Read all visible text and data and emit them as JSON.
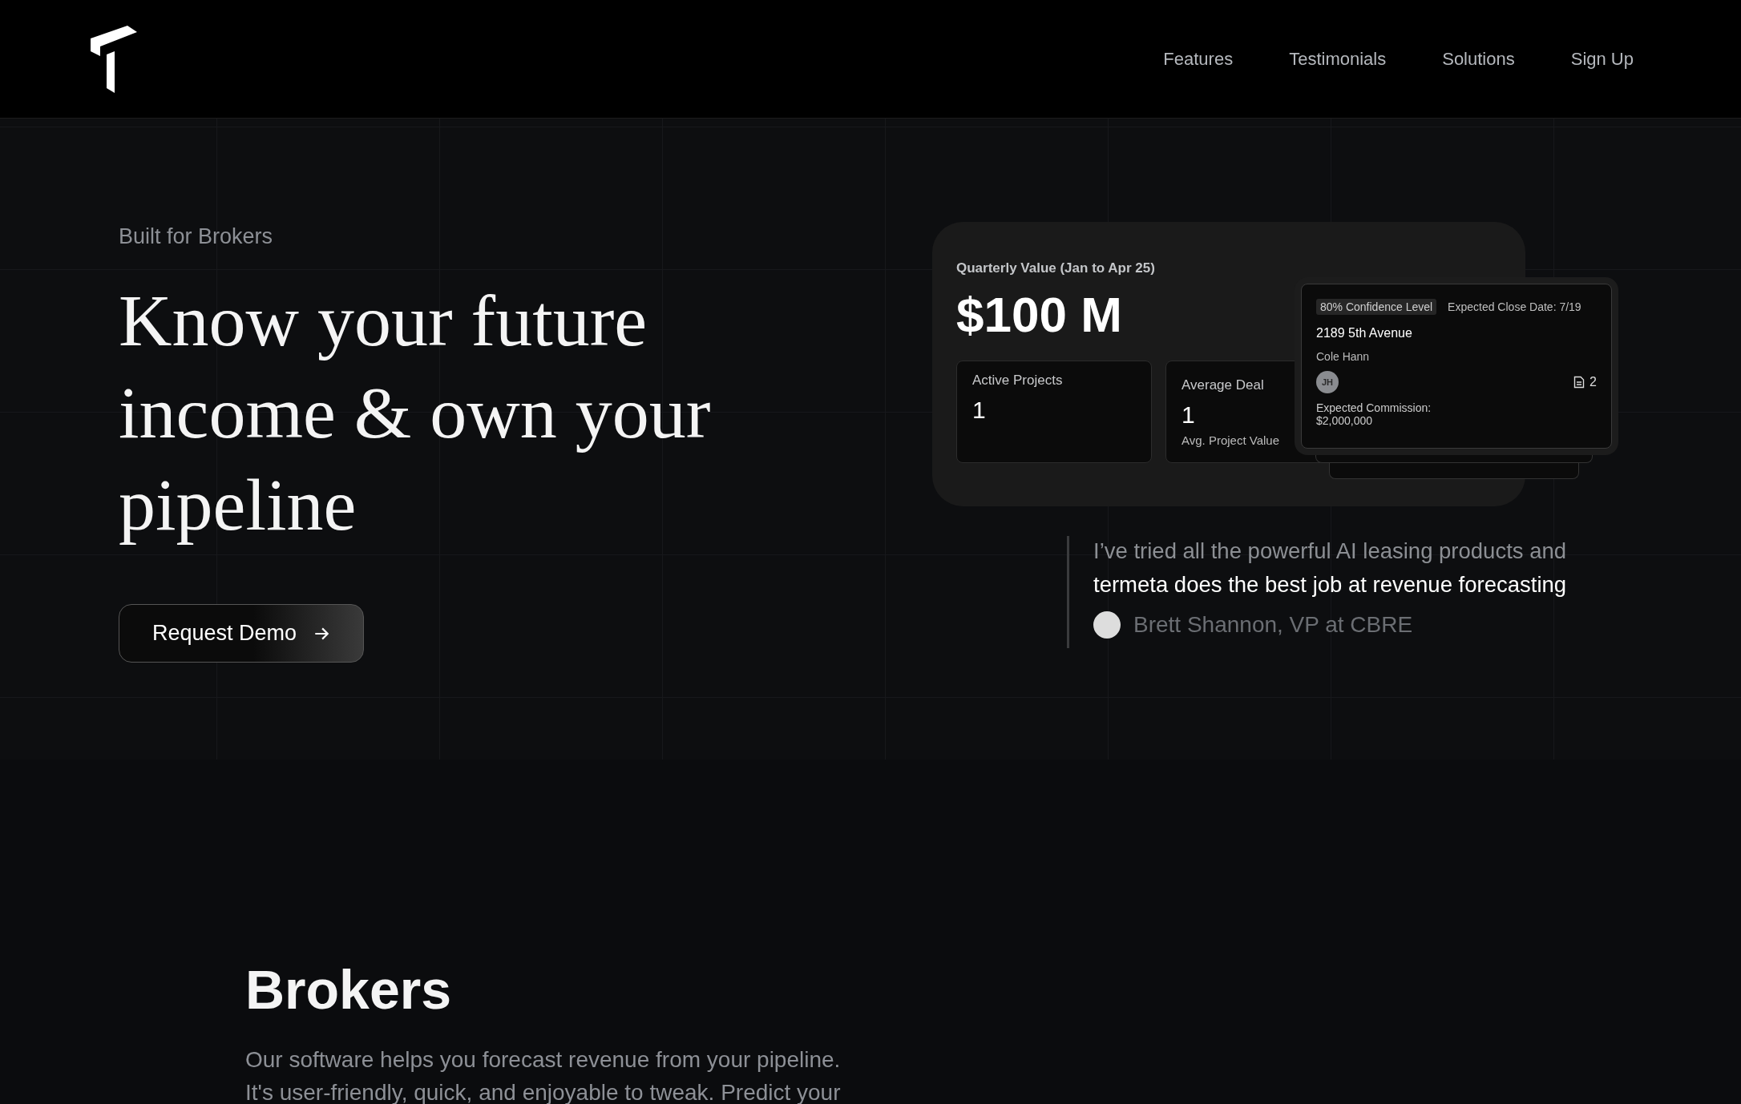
{
  "nav": {
    "links": [
      {
        "label": "Features"
      },
      {
        "label": "Testimonials"
      },
      {
        "label": "Solutions"
      },
      {
        "label": "Sign Up"
      }
    ]
  },
  "hero": {
    "eyebrow": "Built for Brokers",
    "headline": "Know your future income & own your pipeline",
    "cta": "Request Demo"
  },
  "dashboard": {
    "title": "Quarterly Value (Jan to Apr 25)",
    "value": "$100 M",
    "stats": [
      {
        "label": "Active Projects",
        "value": "1"
      },
      {
        "label": "Average Deal",
        "value": "1",
        "caption": "Avg. Project Value"
      }
    ],
    "deal": {
      "badge": "80% Confidence Level",
      "close_date": "Expected Close Date: 7/19",
      "address": "2189 5th Avenue",
      "client": "Cole Hann",
      "initials": "JH",
      "documents": "2",
      "commission_label": "Expected Commission:",
      "commission": "$2,000,000"
    }
  },
  "testimonial": {
    "quote_lead": "I’ve tried all the powerful AI leasing products and",
    "quote_highlight": "termeta does the best job at revenue forecasting",
    "author": "Brett Shannon, VP at CBRE"
  },
  "section": {
    "title": "Brokers",
    "lines": [
      "Our software helps you forecast revenue from your pipeline.",
      "It's user-friendly, quick, and enjoyable to tweak. Predict your"
    ]
  }
}
